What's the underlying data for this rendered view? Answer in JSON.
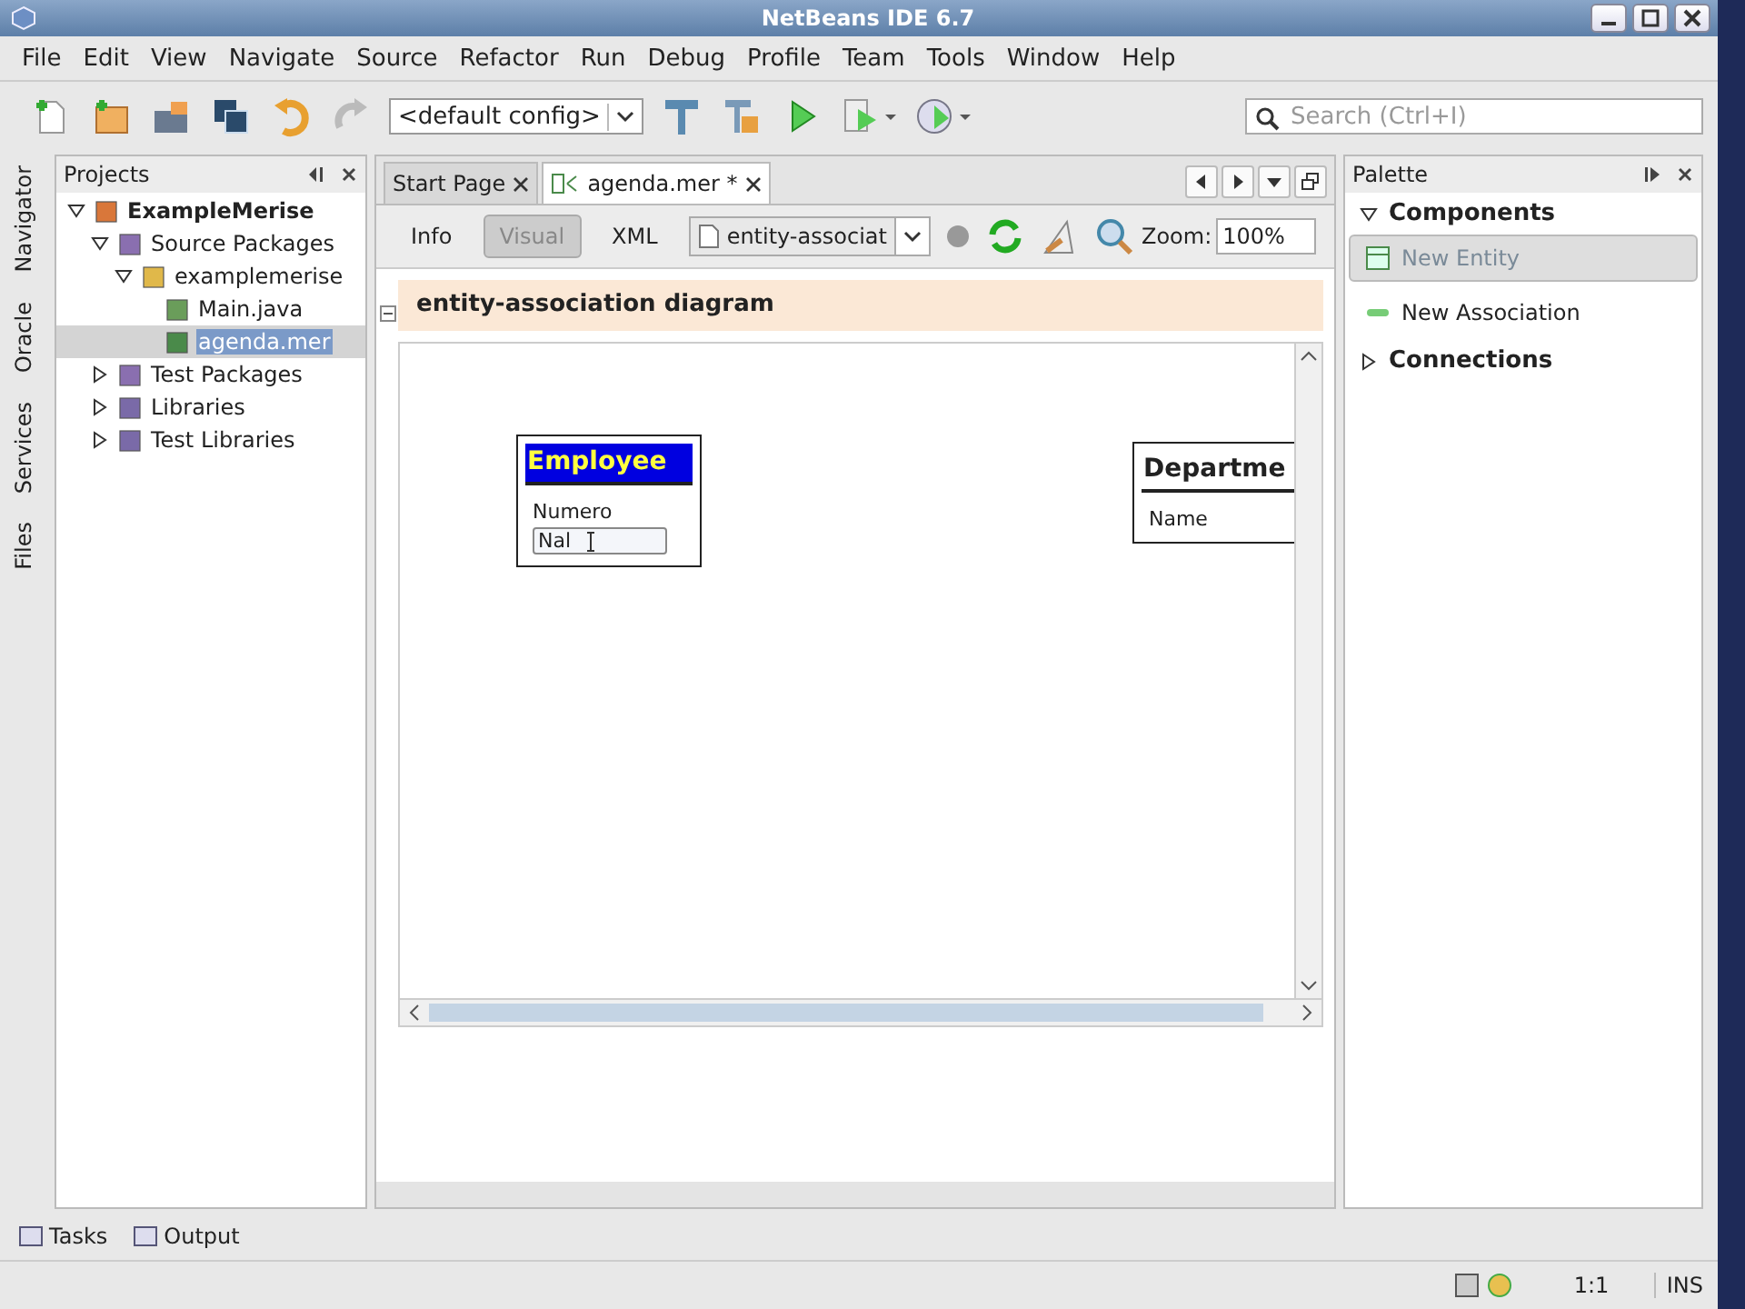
{
  "window": {
    "title": "NetBeans IDE 6.7"
  },
  "menu": [
    "File",
    "Edit",
    "View",
    "Navigate",
    "Source",
    "Refactor",
    "Run",
    "Debug",
    "Profile",
    "Team",
    "Tools",
    "Window",
    "Help"
  ],
  "toolbar": {
    "config": "<default config>",
    "search": {
      "placeholder": "Search (Ctrl+I)"
    }
  },
  "side_tabs": [
    "Navigator",
    "Oracle",
    "Services",
    "Files"
  ],
  "projects": {
    "title": "Projects",
    "tree": [
      {
        "label": "ExampleMerise",
        "kind": "project",
        "expanded": true,
        "selected": false,
        "children": [
          {
            "label": "Source Packages",
            "kind": "source",
            "expanded": true,
            "selected": false,
            "children": [
              {
                "label": "examplemerise",
                "kind": "package",
                "expanded": true,
                "selected": false,
                "children": [
                  {
                    "label": "Main.java",
                    "kind": "java",
                    "selected": false
                  },
                  {
                    "label": "agenda.mer",
                    "kind": "mer",
                    "selected": true
                  }
                ]
              }
            ]
          },
          {
            "label": "Test Packages",
            "kind": "source",
            "expanded": false,
            "selected": false
          },
          {
            "label": "Libraries",
            "kind": "library",
            "expanded": false,
            "selected": false
          },
          {
            "label": "Test Libraries",
            "kind": "library",
            "expanded": false,
            "selected": false
          }
        ]
      }
    ]
  },
  "editor": {
    "tabs": [
      {
        "label": "Start Page",
        "selected": false
      },
      {
        "label": "agenda.mer *",
        "selected": true
      }
    ],
    "views": [
      {
        "label": "Info",
        "selected": false
      },
      {
        "label": "Visual",
        "selected": true
      },
      {
        "label": "XML",
        "selected": false
      }
    ],
    "diagram_select": "entity-associat",
    "zoom_label": "Zoom:",
    "zoom": "100%",
    "diagram_title": "entity-association diagram",
    "entities": [
      {
        "name": "Employee",
        "selected": true,
        "attributes": [
          {
            "label": "Numero",
            "kind": "text"
          },
          {
            "label": "Nal",
            "kind": "input"
          }
        ]
      },
      {
        "name": "Departme",
        "selected": false,
        "attributes": [
          {
            "label": "Name",
            "kind": "text"
          }
        ]
      }
    ]
  },
  "palette": {
    "title": "Palette",
    "categories": [
      {
        "label": "Components",
        "expanded": true,
        "items": [
          {
            "label": "New Entity",
            "kind": "entity",
            "selected": true
          },
          {
            "label": "New Association",
            "kind": "association",
            "selected": false
          }
        ]
      },
      {
        "label": "Connections",
        "expanded": false
      }
    ]
  },
  "bottom_tabs": [
    "Tasks",
    "Output"
  ],
  "status_bar": {
    "position": "1:1",
    "mode": "INS"
  }
}
